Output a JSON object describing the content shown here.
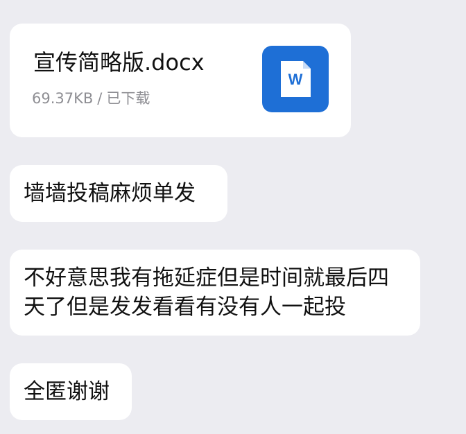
{
  "file_message": {
    "file_name": "宣传简略版.docx",
    "file_size": "69.37KB",
    "separator": "/",
    "download_status": "已下载",
    "icon": "word-document-icon",
    "icon_letter": "W",
    "icon_color": "#1e6fd6"
  },
  "messages": [
    {
      "text": "墙墙投稿麻烦单发"
    },
    {
      "text": "不好意思我有拖延症但是时间就最后四天了但是发发看看有没有人一起投"
    },
    {
      "text": "全匿谢谢"
    }
  ],
  "colors": {
    "background": "#ececf1",
    "bubble": "#ffffff",
    "secondary_text": "#8e8e93"
  }
}
